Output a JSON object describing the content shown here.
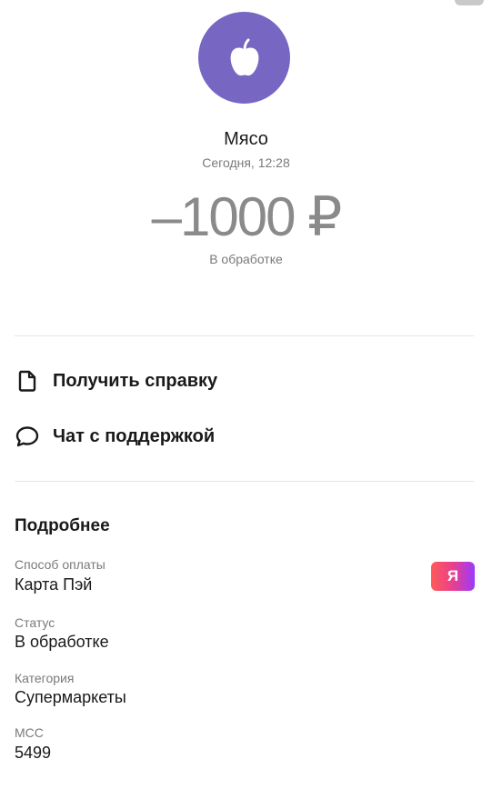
{
  "transaction": {
    "merchant": "Мясо",
    "date": "Сегодня, 12:28",
    "amount": "–1000 ₽",
    "status": "В обработке",
    "logo_icon": "apple-icon",
    "logo_color": "#7766c2"
  },
  "actions": [
    {
      "label": "Получить справку",
      "icon": "document-icon"
    },
    {
      "label": "Чат с поддержкой",
      "icon": "chat-bubble-icon"
    }
  ],
  "details": {
    "title": "Подробнее",
    "rows": [
      {
        "label": "Способ оплаты",
        "value": "Карта Пэй"
      },
      {
        "label": "Статус",
        "value": "В обработке"
      },
      {
        "label": "Категория",
        "value": "Супермаркеты"
      },
      {
        "label": "MCC",
        "value": "5499"
      }
    ],
    "payment_badge": "Я"
  }
}
